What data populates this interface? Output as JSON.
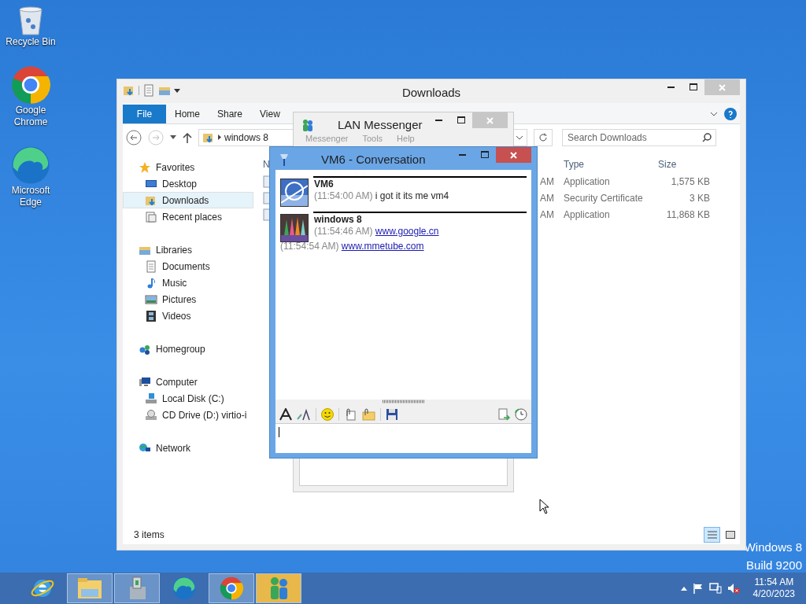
{
  "desktop": {
    "icons": [
      {
        "label": "Recycle Bin",
        "kind": "bin"
      },
      {
        "label": "Google Chrome",
        "kind": "chrome"
      },
      {
        "label": "Microsoft Edge",
        "kind": "edge"
      }
    ],
    "watermark": [
      "Windows 8",
      "Build 9200"
    ]
  },
  "explorer": {
    "title": "Downloads",
    "tabs": [
      {
        "label": "File",
        "kind": "backstage"
      },
      {
        "label": "Home",
        "kind": "tab"
      },
      {
        "label": "Share",
        "kind": "tab"
      },
      {
        "label": "View",
        "kind": "tab"
      }
    ],
    "address": "windows 8",
    "search": {
      "placeholder": "Search Downloads"
    },
    "nav": [
      {
        "label": "Favorites",
        "kind": "star",
        "selected": false,
        "children": [
          {
            "label": "Desktop",
            "kind": "desktop",
            "selected": false
          },
          {
            "label": "Downloads",
            "kind": "downloads",
            "selected": true
          },
          {
            "label": "Recent places",
            "kind": "recent",
            "selected": false
          }
        ]
      },
      {
        "label": "Libraries",
        "kind": "library",
        "selected": false,
        "children": [
          {
            "label": "Documents",
            "kind": "document",
            "selected": false
          },
          {
            "label": "Music",
            "kind": "music",
            "selected": false
          },
          {
            "label": "Pictures",
            "kind": "picture",
            "selected": false
          },
          {
            "label": "Videos",
            "kind": "video",
            "selected": false
          }
        ]
      },
      {
        "label": "Homegroup",
        "kind": "homegroup",
        "selected": false
      },
      {
        "label": "Computer",
        "kind": "computer",
        "selected": false,
        "children": [
          {
            "label": "Local Disk (C:)",
            "kind": "disk",
            "selected": false
          },
          {
            "label": "CD Drive (D:) virtio-і",
            "kind": "cd",
            "selected": false
          }
        ]
      },
      {
        "label": "Network",
        "kind": "network",
        "selected": false
      }
    ],
    "columns": [
      "N",
      "Type",
      "Size"
    ],
    "rows": [
      {
        "column_2": "AM",
        "type": "Application",
        "size": "1,575 KB"
      },
      {
        "column_2": "AM",
        "type": "Security Certificate",
        "size": "3 KB"
      },
      {
        "column_2": "AM",
        "type": "Application",
        "size": "11,868 KB"
      }
    ],
    "status": "3 items"
  },
  "messenger": {
    "title": "LAN Messenger",
    "menu": [
      "Messenger",
      "Tools",
      "Help"
    ]
  },
  "conversation": {
    "title": "VM6 - Conversation",
    "messages": [
      {
        "kind": "header",
        "sender": "VM6",
        "time": "(11:54:00 AM)",
        "text": "i got it its me vm4"
      },
      {
        "kind": "header",
        "sender": "windows 8",
        "time": "(11:54:46 AM)",
        "link": "www.google.cn"
      },
      {
        "kind": "continued",
        "time": "(11:54:54 AM)",
        "link": "www.mmetube.com"
      }
    ]
  },
  "taskbar": {
    "items": [
      {
        "kind": "ie",
        "running": false,
        "selected": false
      },
      {
        "kind": "explorer",
        "running": true,
        "selected": false
      },
      {
        "kind": "setup",
        "running": true,
        "selected": false
      },
      {
        "kind": "edge",
        "running": false,
        "selected": false
      },
      {
        "kind": "chrome",
        "running": true,
        "selected": false
      },
      {
        "kind": "messenger",
        "running": true,
        "selected": true
      }
    ],
    "time": "11:54 AM",
    "date": "4/20/2023"
  }
}
